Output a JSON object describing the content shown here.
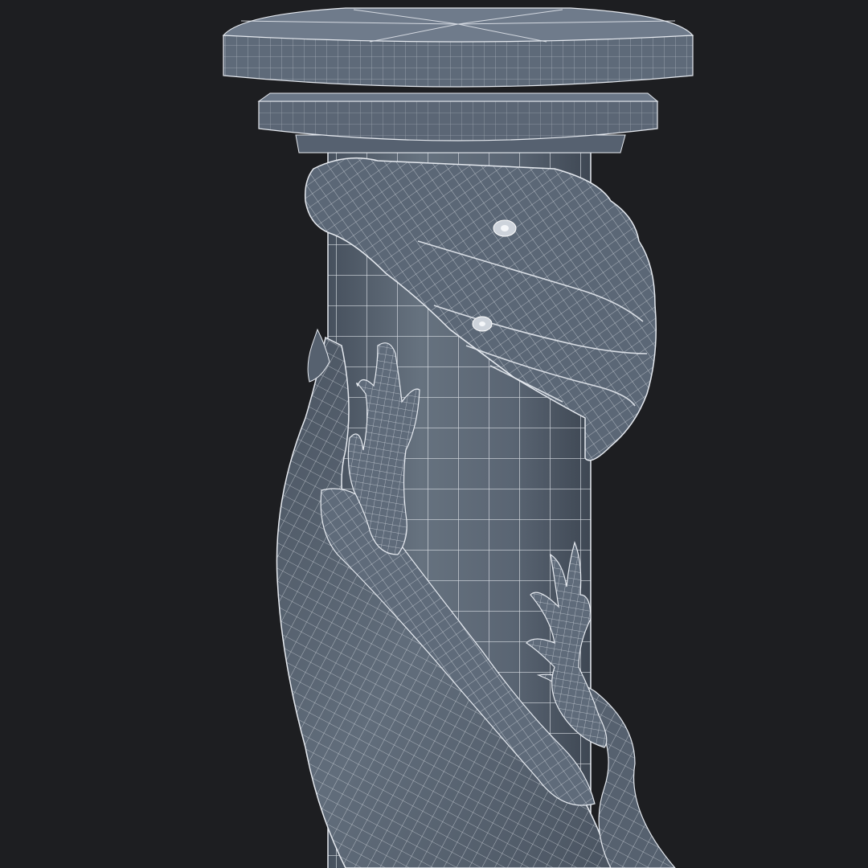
{
  "viewport": {
    "subject": "wireframe-render",
    "colors": {
      "background": "#1d1e21",
      "mesh_fill": "#5d6978",
      "mesh_fill_dark": "#3f4855",
      "mesh_fill_light": "#748193",
      "wire": "#e6eaf0"
    }
  }
}
